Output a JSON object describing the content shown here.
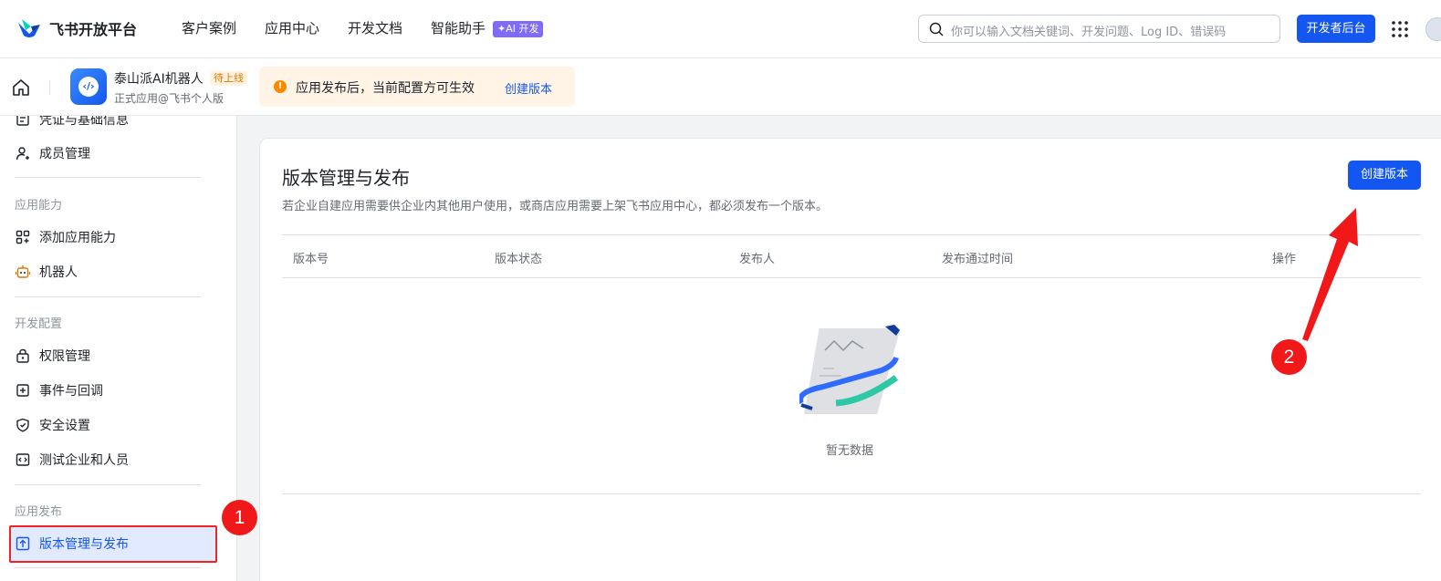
{
  "topbar": {
    "logo_text": "飞书开放平台",
    "nav": [
      "客户案例",
      "应用中心",
      "开发文档",
      "智能助手"
    ],
    "ai_badge": "✦AI 开发",
    "search_placeholder": "你可以输入文档关键词、开发问题、Log ID、错误码",
    "dev_console": "开发者后台"
  },
  "subbar": {
    "app_name": "泰山派AI机器人",
    "app_status": "待上线",
    "app_sub": "正式应用@飞书个人版",
    "notice_text": "应用发布后，当前配置方可生效",
    "notice_link": "创建版本"
  },
  "sidebar": {
    "items_top": [
      {
        "label": "凭证与基础信息",
        "icon": "credential-icon"
      },
      {
        "label": "成员管理",
        "icon": "member-icon"
      }
    ],
    "group1": "应用能力",
    "group1_items": [
      {
        "label": "添加应用能力",
        "icon": "add-capability-icon"
      },
      {
        "label": "机器人",
        "icon": "robot-icon"
      }
    ],
    "group2": "开发配置",
    "group2_items": [
      {
        "label": "权限管理",
        "icon": "lock-icon"
      },
      {
        "label": "事件与回调",
        "icon": "event-icon"
      },
      {
        "label": "安全设置",
        "icon": "shield-icon"
      },
      {
        "label": "测试企业和人员",
        "icon": "code-icon"
      }
    ],
    "group3": "应用发布",
    "active_item": {
      "label": "版本管理与发布",
      "icon": "upload-icon"
    }
  },
  "markers": {
    "m1": "1",
    "m2": "2"
  },
  "main": {
    "title": "版本管理与发布",
    "description": "若企业自建应用需要供企业内其他用户使用，或商店应用需要上架飞书应用中心，都必须发布一个版本。",
    "create_button": "创建版本",
    "columns": [
      "版本号",
      "版本状态",
      "发布人",
      "发布通过时间",
      "操作"
    ],
    "rows": [],
    "empty_text": "暂无数据"
  },
  "colors": {
    "accent": "#1456f0",
    "marker": "#f01818",
    "notice_bg": "#fff4e6"
  }
}
